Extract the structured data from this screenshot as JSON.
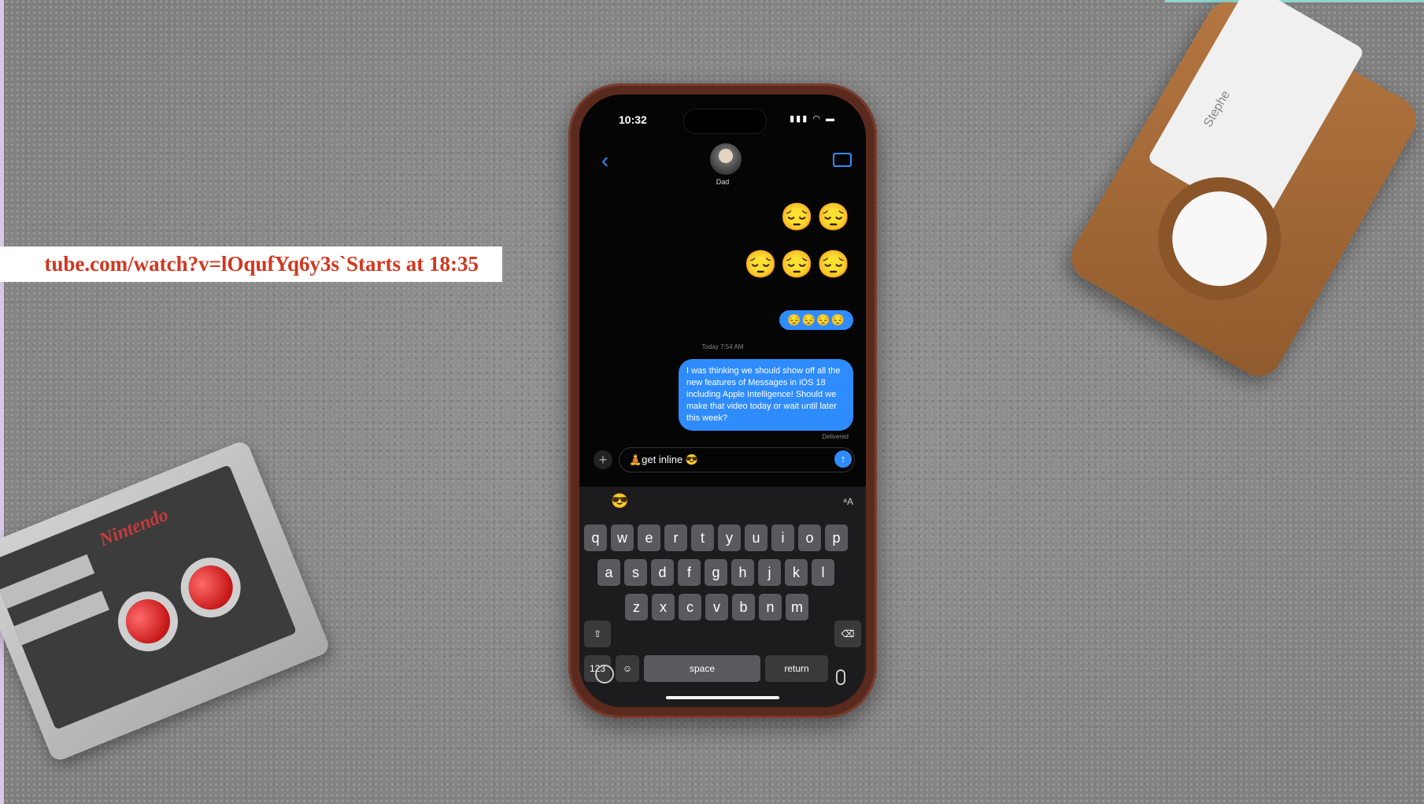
{
  "banner": {
    "url_text": "tube.com/watch?v=lOqufYq6y3s`Starts at 18:35"
  },
  "controller": {
    "brand": "Nintendo"
  },
  "wallet": {
    "name": "Stephe"
  },
  "phone": {
    "status": {
      "time": "10:32",
      "icons": "▮▮▮ ◠ ▬"
    },
    "contact": {
      "name": "Dad"
    },
    "emoji_rows": [
      "😔😔",
      "😔😔😔"
    ],
    "emoji_bubble": "😔😔😔😔",
    "timestamp": "Today 7:54 AM",
    "message": "I was thinking we should show off all the new features of Messages in iOS 18 including Apple Intelligence! Should we make that video today or wait until later this week?",
    "delivered": "Delivered",
    "input_value": "🧘get inline 😎",
    "keyboard": {
      "suggestion_emoji": "😎",
      "suggestion_aa": "ᵃA",
      "row1": [
        "q",
        "w",
        "e",
        "r",
        "t",
        "y",
        "u",
        "i",
        "o",
        "p"
      ],
      "row2": [
        "a",
        "s",
        "d",
        "f",
        "g",
        "h",
        "j",
        "k",
        "l"
      ],
      "row3": [
        "z",
        "x",
        "c",
        "v",
        "b",
        "n",
        "m"
      ],
      "shift": "⇧",
      "delete": "⌫",
      "numbers": "123",
      "emoji_key": "☺",
      "space": "space",
      "return": "return"
    }
  }
}
